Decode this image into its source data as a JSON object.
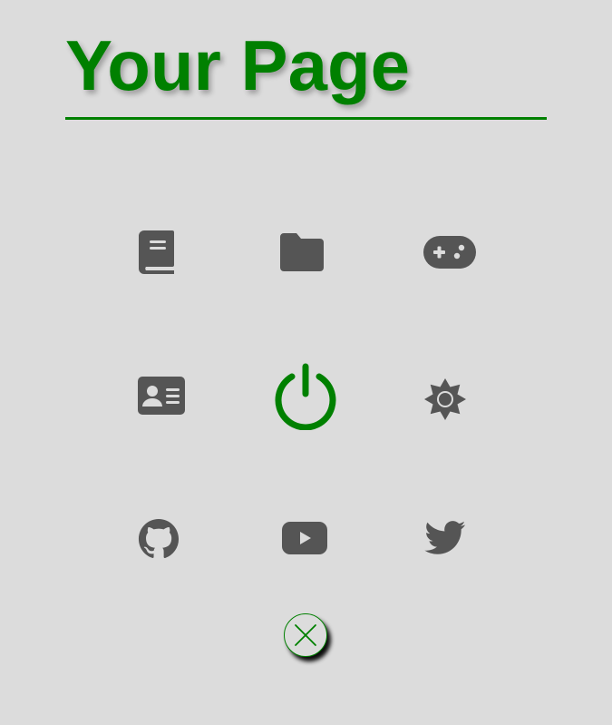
{
  "header": {
    "title": "Your Page"
  },
  "colors": {
    "accent": "#008000",
    "icon": "#555555",
    "background": "#dcdcdc"
  },
  "icon_grid": [
    {
      "name": "book-icon"
    },
    {
      "name": "folder-icon"
    },
    {
      "name": "gamepad-icon"
    },
    {
      "name": "id-card-icon"
    },
    {
      "name": "power-icon"
    },
    {
      "name": "sun-icon"
    },
    {
      "name": "github-icon"
    },
    {
      "name": "youtube-icon"
    },
    {
      "name": "twitter-icon"
    }
  ],
  "close_button": {
    "icon": "close-icon"
  }
}
